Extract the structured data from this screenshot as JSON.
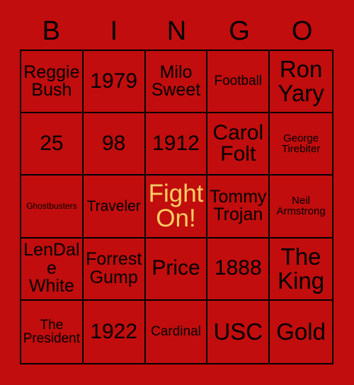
{
  "card": {
    "title": "BINGO",
    "background_color": "#c10d0d",
    "grid_line_color": "#000000",
    "text_color": "#000000",
    "free_space_color": "#fcce63",
    "header_letters": [
      "B",
      "I",
      "N",
      "G",
      "O"
    ],
    "rows": 5,
    "columns": 5,
    "cells": [
      [
        {
          "text": "Reggie Bush",
          "size": "md",
          "free": false
        },
        {
          "text": "1979",
          "size": "lg",
          "free": false
        },
        {
          "text": "Milo Sweet",
          "size": "md",
          "free": false
        },
        {
          "text": "Football",
          "size": "xs",
          "free": false
        },
        {
          "text": "Ron Yary",
          "size": "xl",
          "free": false
        }
      ],
      [
        {
          "text": "25",
          "size": "lg",
          "free": false
        },
        {
          "text": "98",
          "size": "lg",
          "free": false
        },
        {
          "text": "1912",
          "size": "lg",
          "free": false
        },
        {
          "text": "Carol Folt",
          "size": "lg",
          "free": false
        },
        {
          "text": "George Tirebiter",
          "size": "xxs",
          "free": false
        }
      ],
      [
        {
          "text": "Ghostbusters",
          "size": "tiny",
          "free": false
        },
        {
          "text": "Traveler",
          "size": "sm",
          "free": false
        },
        {
          "text": "Fight On!",
          "size": "free",
          "free": true
        },
        {
          "text": "Tommy Trojan",
          "size": "md",
          "free": false
        },
        {
          "text": "Neil Armstrong",
          "size": "xxs",
          "free": false
        }
      ],
      [
        {
          "text": "LenDale White",
          "size": "md",
          "free": false
        },
        {
          "text": "Forrest Gump",
          "size": "md",
          "free": false
        },
        {
          "text": "Price",
          "size": "lg",
          "free": false
        },
        {
          "text": "1888",
          "size": "lg",
          "free": false
        },
        {
          "text": "The King",
          "size": "xl",
          "free": false
        }
      ],
      [
        {
          "text": "The President",
          "size": "xs",
          "free": false
        },
        {
          "text": "1922",
          "size": "lg",
          "free": false
        },
        {
          "text": "Cardinal",
          "size": "xs",
          "free": false
        },
        {
          "text": "USC",
          "size": "xl",
          "free": false
        },
        {
          "text": "Gold",
          "size": "xl",
          "free": false
        }
      ]
    ]
  }
}
